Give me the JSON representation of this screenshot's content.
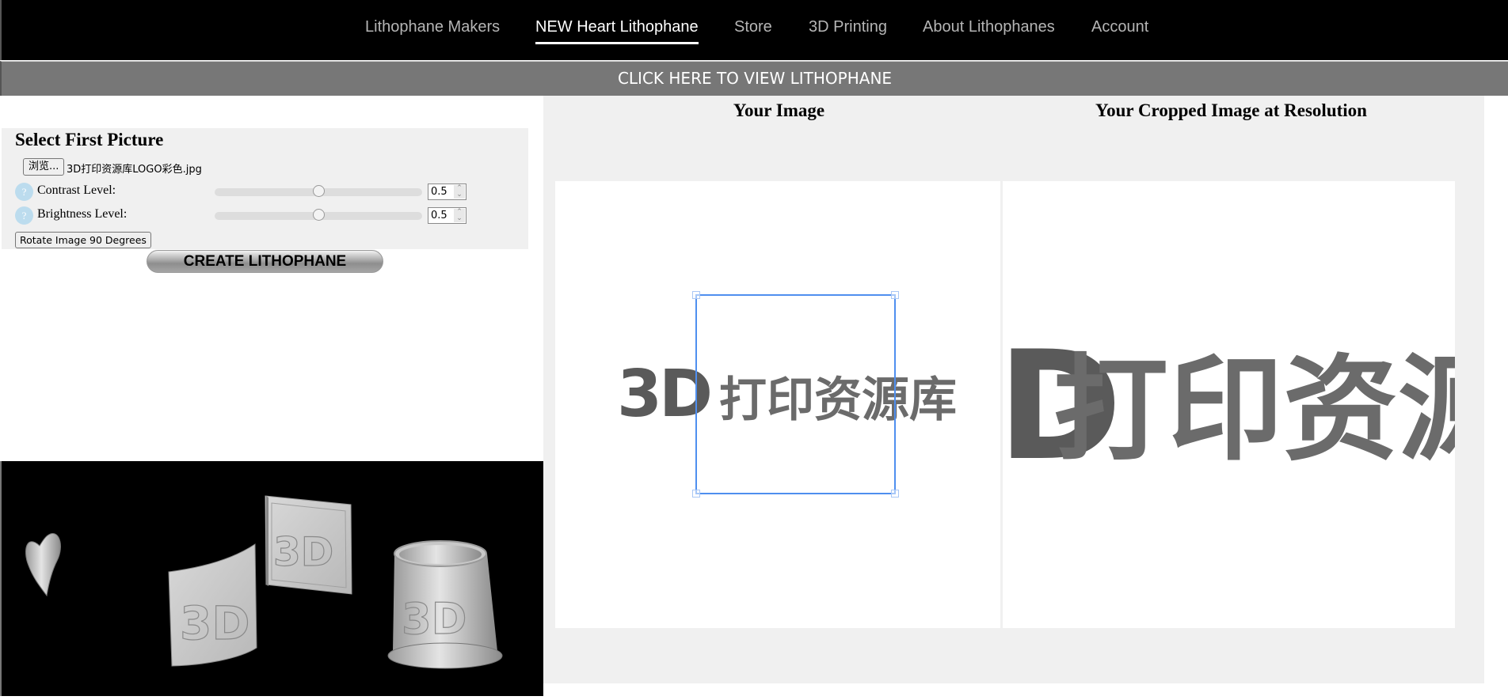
{
  "nav": {
    "items": [
      {
        "label": "Lithophane Makers",
        "active": false
      },
      {
        "label": "NEW Heart Lithophane",
        "active": true
      },
      {
        "label": "Store",
        "active": false
      },
      {
        "label": "3D Printing",
        "active": false
      },
      {
        "label": "About Lithophanes",
        "active": false
      },
      {
        "label": "Account",
        "active": false
      }
    ]
  },
  "banner": {
    "label": "CLICK HERE TO VIEW LITHOPHANE"
  },
  "form": {
    "title": "Select First Picture",
    "browse_label": "浏览...",
    "file_name": "3D打印资源库LOGO彩色.jpg",
    "help_icon": "?",
    "contrast": {
      "label": "Contrast Level:",
      "value": "0.5",
      "fraction": 0.5
    },
    "brightness": {
      "label": "Brightness Level:",
      "value": "0.5",
      "fraction": 0.5
    },
    "spin_icon": "⌃⌄",
    "rotate_label": "Rotate Image 90 Degrees",
    "create_label": "CREATE LITHOPHANE"
  },
  "preview": {
    "objects": [
      "heart-lithophane",
      "curved-lithophane",
      "flat-lithophane",
      "cylinder-lithophane"
    ],
    "relief_text": "3D"
  },
  "image_panel": {
    "your_image_title": "Your Image",
    "cropped_title": "Your Cropped Image at Resolution",
    "logo_latin": "3D",
    "logo_chinese": "打印资源库"
  },
  "colors": {
    "nav_bg": "#000000",
    "banner_bg": "#777777",
    "panel_bg": "#f0f0f0",
    "crop_border": "#4f8fef",
    "logo_gray": "#6b6b6b"
  }
}
